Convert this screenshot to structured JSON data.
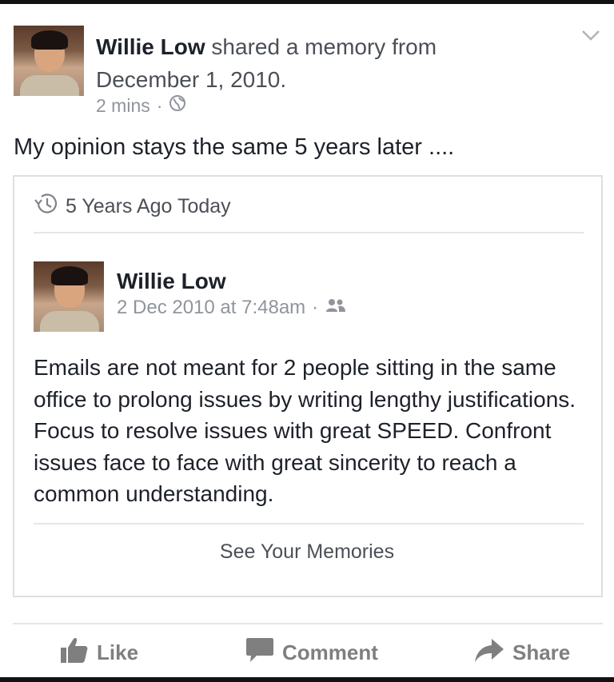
{
  "post": {
    "author": "Willie Low",
    "action": "shared a memory from December 1, 2010.",
    "time": "2 mins",
    "separator": "·",
    "status_text": "My opinion stays the same 5 years later ...."
  },
  "memory": {
    "header": "5 Years Ago Today",
    "author": "Willie Low",
    "timestamp": "2 Dec 2010 at 7:48am",
    "separator": "·",
    "body": "Emails are not meant for 2 people sitting in the same office to prolong issues by writing lengthy justifications. Focus to resolve issues with great SPEED. Confront issues face to face with great sincerity to reach a common understanding.",
    "see_memories": "See Your Memories"
  },
  "actions": {
    "like": "Like",
    "comment": "Comment",
    "share": "Share"
  },
  "icons": {
    "globe": "globe-icon",
    "history": "history-icon",
    "friends": "friends-icon",
    "chevron": "chevron-down-icon",
    "like": "thumbs-up-icon",
    "comment": "speech-bubble-icon",
    "share": "share-arrow-icon"
  },
  "colors": {
    "text": "#1d2129",
    "secondary": "#90949c",
    "action": "#7f7f7f",
    "border": "#dddfe2"
  }
}
